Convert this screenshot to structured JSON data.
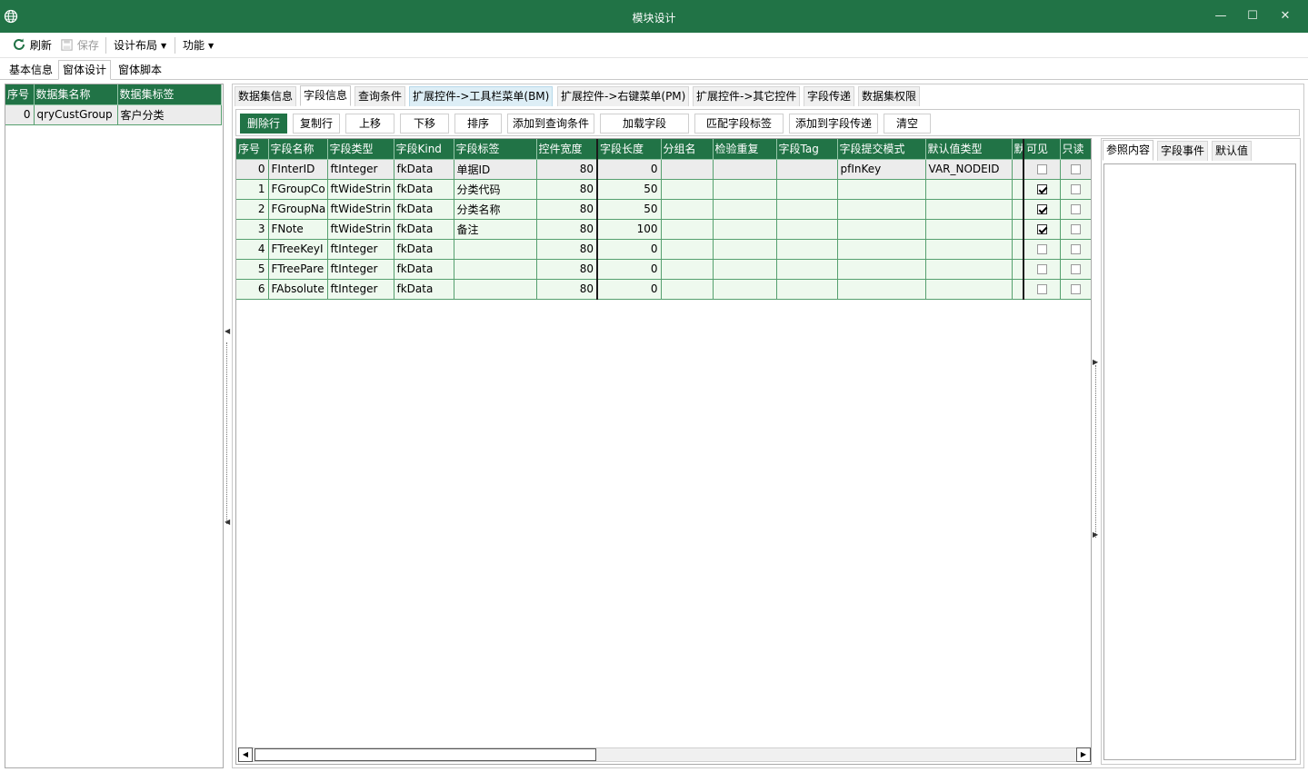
{
  "window": {
    "title": "模块设计",
    "minimize": "—",
    "maximize": "☐",
    "close": "✕"
  },
  "toolbar": {
    "refresh": "刷新",
    "save": "保存",
    "design_layout": "设计布局",
    "function": "功能"
  },
  "main_tabs": [
    "基本信息",
    "窗体设计",
    "窗体脚本"
  ],
  "dataset_grid": {
    "headers": [
      "序号",
      "数据集名称",
      "数据集标签"
    ],
    "rows": [
      {
        "index": "0",
        "name": "qryCustGroup",
        "label": "客户分类"
      }
    ]
  },
  "sub_tabs": [
    "数据集信息",
    "字段信息",
    "查询条件",
    "扩展控件->工具栏菜单(BM)",
    "扩展控件->右键菜单(PM)",
    "扩展控件->其它控件",
    "字段传递",
    "数据集权限"
  ],
  "buttons": [
    "删除行",
    "复制行",
    "上移",
    "下移",
    "排序",
    "添加到查询条件",
    "加载字段",
    "匹配字段标签",
    "添加到字段传递",
    "清空"
  ],
  "field_grid": {
    "headers": [
      "序号",
      "字段名称",
      "字段类型",
      "字段Kind",
      "字段标签",
      "控件宽度",
      "字段长度",
      "分组名",
      "检验重复",
      "字段Tag",
      "字段提交模式",
      "默认值类型",
      "默",
      "可见",
      "只读"
    ],
    "rows": [
      {
        "index": "0",
        "name": "FInterID",
        "type": "ftInteger",
        "kind": "fkData",
        "label": "单据ID",
        "width": "80",
        "length": "0",
        "group": "",
        "check": "",
        "tag": "",
        "submit": "pfInKey",
        "default_type": "VAR_NODEID",
        "visible": false,
        "readonly": false
      },
      {
        "index": "1",
        "name": "FGroupCo",
        "type": "ftWideStrin",
        "kind": "fkData",
        "label": "分类代码",
        "width": "80",
        "length": "50",
        "group": "",
        "check": "",
        "tag": "",
        "submit": "",
        "default_type": "",
        "visible": true,
        "readonly": false
      },
      {
        "index": "2",
        "name": "FGroupNa",
        "type": "ftWideStrin",
        "kind": "fkData",
        "label": "分类名称",
        "width": "80",
        "length": "50",
        "group": "",
        "check": "",
        "tag": "",
        "submit": "",
        "default_type": "",
        "visible": true,
        "readonly": false
      },
      {
        "index": "3",
        "name": "FNote",
        "type": "ftWideStrin",
        "kind": "fkData",
        "label": "备注",
        "width": "80",
        "length": "100",
        "group": "",
        "check": "",
        "tag": "",
        "submit": "",
        "default_type": "",
        "visible": true,
        "readonly": false
      },
      {
        "index": "4",
        "name": "FTreeKeyI",
        "type": "ftInteger",
        "kind": "fkData",
        "label": "",
        "width": "80",
        "length": "0",
        "group": "",
        "check": "",
        "tag": "",
        "submit": "",
        "default_type": "",
        "visible": false,
        "readonly": false
      },
      {
        "index": "5",
        "name": "FTreePare",
        "type": "ftInteger",
        "kind": "fkData",
        "label": "",
        "width": "80",
        "length": "0",
        "group": "",
        "check": "",
        "tag": "",
        "submit": "",
        "default_type": "",
        "visible": false,
        "readonly": false
      },
      {
        "index": "6",
        "name": "FAbsolute",
        "type": "ftInteger",
        "kind": "fkData",
        "label": "",
        "width": "80",
        "length": "0",
        "group": "",
        "check": "",
        "tag": "",
        "submit": "",
        "default_type": "",
        "visible": false,
        "readonly": false
      }
    ]
  },
  "side_tabs": [
    "参照内容",
    "字段事件",
    "默认值"
  ],
  "colors": {
    "accent": "#217346",
    "row_bg": "#eef9ee",
    "selected_row": "#ececec"
  }
}
